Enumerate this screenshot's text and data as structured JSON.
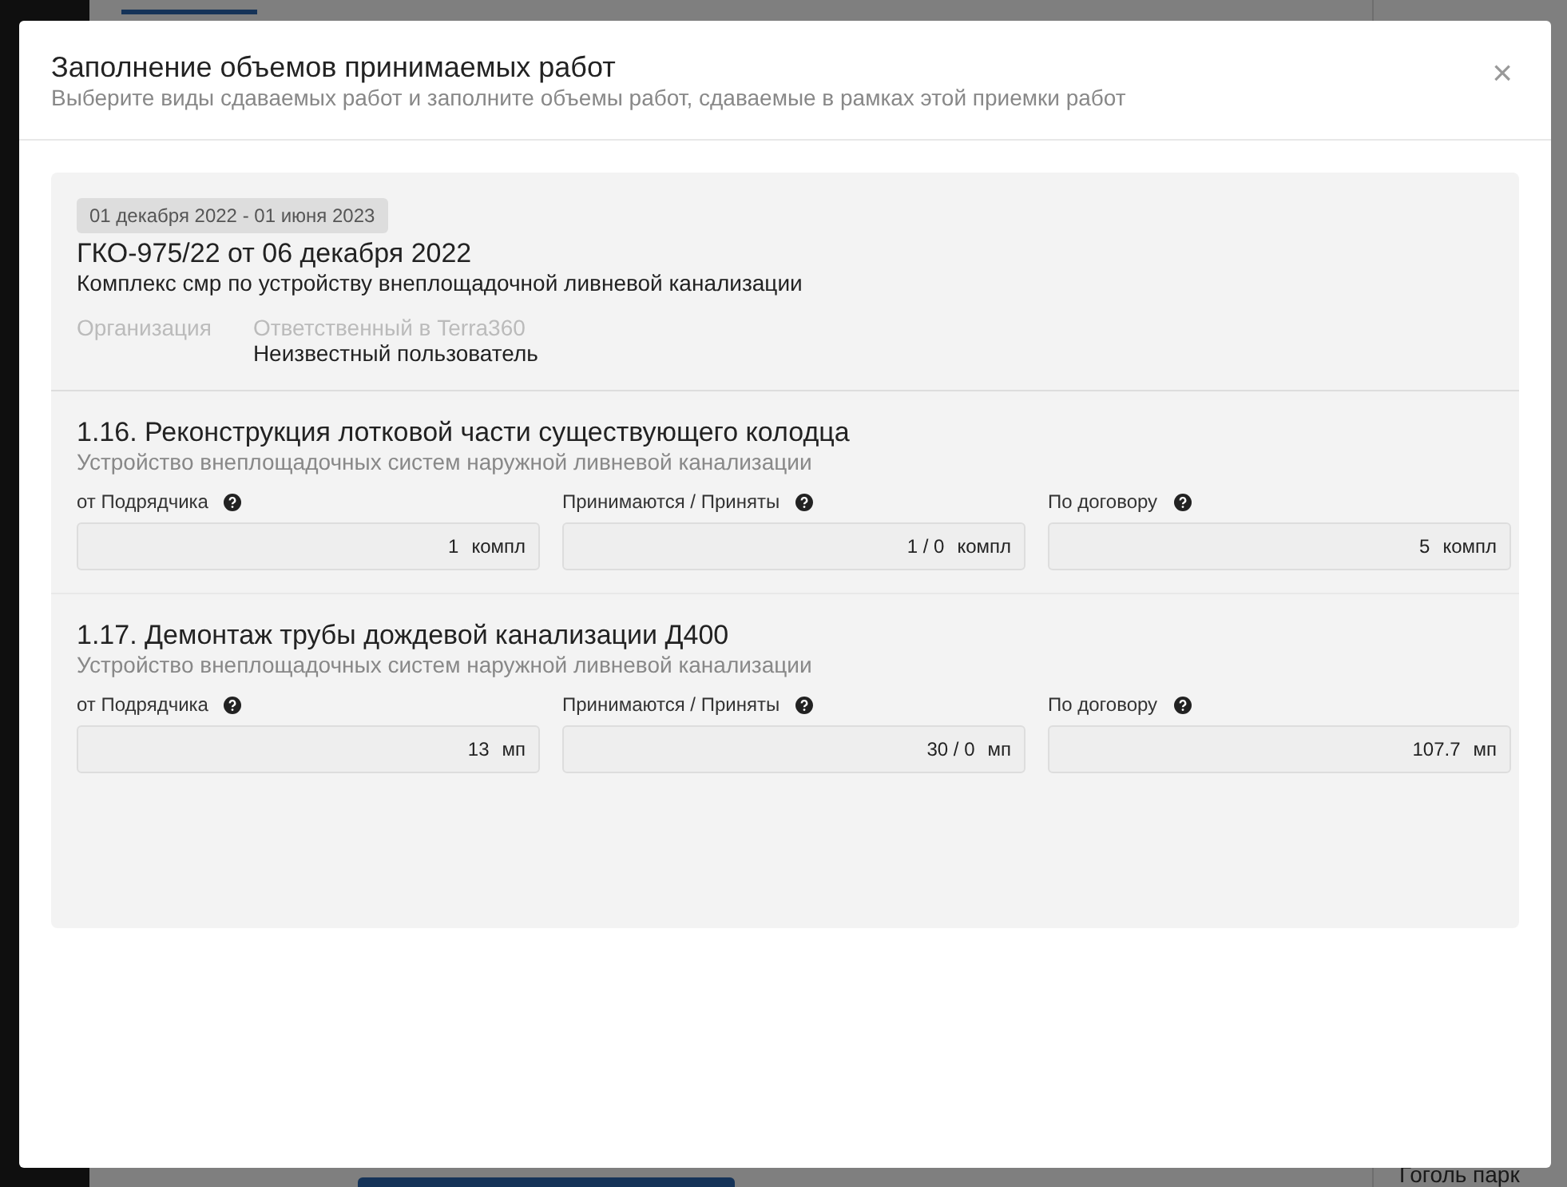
{
  "background": {
    "footer_text": "Гоголь парк"
  },
  "modal": {
    "title": "Заполнение объемов принимаемых работ",
    "subtitle": "Выберите виды сдаваемых работ и заполните объемы работ, сдаваемые в рамках этой приемки работ",
    "close": "×",
    "contract": {
      "period": "01 декабря 2022 - 01 июня 2023",
      "number": "ГКО-975/22 от 06 декабря 2022",
      "description": "Комплекс смр по устройству внеплощадочной ливневой канализации",
      "organization_label": "Организация",
      "responsible_label": "Ответственный в Terra360",
      "responsible_value": "Неизвестный пользователь"
    },
    "works": [
      {
        "title": "1.16. Реконструкция лотковой части существующего колодца",
        "subtitle": "Устройство внеплощадочных систем наружной ливневой канализации",
        "fields": [
          {
            "label": "от Подрядчика",
            "value": "1",
            "unit": "компл"
          },
          {
            "label": "Принимаются / Приняты",
            "value": "1 / 0",
            "unit": "компл"
          },
          {
            "label": "По договору",
            "value": "5",
            "unit": "компл"
          }
        ]
      },
      {
        "title": "1.17. Демонтаж трубы дождевой канализации Д400",
        "subtitle": "Устройство внеплощадочных систем наружной ливневой канализации",
        "fields": [
          {
            "label": "от Подрядчика",
            "value": "13",
            "unit": "мп"
          },
          {
            "label": "Принимаются / Приняты",
            "value": "30 / 0",
            "unit": "мп"
          },
          {
            "label": "По договору",
            "value": "107.7",
            "unit": "мп"
          }
        ]
      }
    ]
  }
}
